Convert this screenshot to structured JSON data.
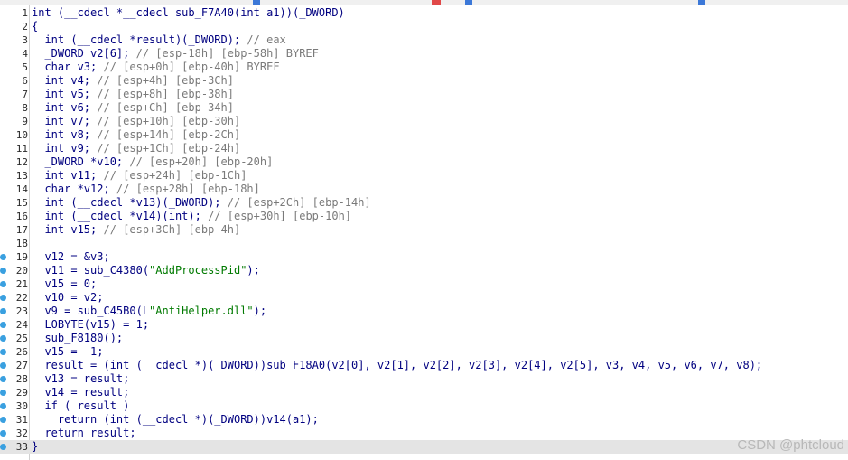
{
  "code_lines": [
    {
      "n": "1",
      "bp": false,
      "current": false,
      "text": "int (__cdecl *__cdecl sub_F7A40(int a1))(_DWORD)"
    },
    {
      "n": "2",
      "bp": false,
      "current": false,
      "text": "{"
    },
    {
      "n": "3",
      "bp": false,
      "current": false,
      "text": "  int (__cdecl *result)(_DWORD); // eax"
    },
    {
      "n": "4",
      "bp": false,
      "current": false,
      "text": "  _DWORD v2[6]; // [esp-18h] [ebp-58h] BYREF"
    },
    {
      "n": "5",
      "bp": false,
      "current": false,
      "text": "  char v3; // [esp+0h] [ebp-40h] BYREF"
    },
    {
      "n": "6",
      "bp": false,
      "current": false,
      "text": "  int v4; // [esp+4h] [ebp-3Ch]"
    },
    {
      "n": "7",
      "bp": false,
      "current": false,
      "text": "  int v5; // [esp+8h] [ebp-38h]"
    },
    {
      "n": "8",
      "bp": false,
      "current": false,
      "text": "  int v6; // [esp+Ch] [ebp-34h]"
    },
    {
      "n": "9",
      "bp": false,
      "current": false,
      "text": "  int v7; // [esp+10h] [ebp-30h]"
    },
    {
      "n": "10",
      "bp": false,
      "current": false,
      "text": "  int v8; // [esp+14h] [ebp-2Ch]"
    },
    {
      "n": "11",
      "bp": false,
      "current": false,
      "text": "  int v9; // [esp+1Ch] [ebp-24h]"
    },
    {
      "n": "12",
      "bp": false,
      "current": false,
      "text": "  _DWORD *v10; // [esp+20h] [ebp-20h]"
    },
    {
      "n": "13",
      "bp": false,
      "current": false,
      "text": "  int v11; // [esp+24h] [ebp-1Ch]"
    },
    {
      "n": "14",
      "bp": false,
      "current": false,
      "text": "  char *v12; // [esp+28h] [ebp-18h]"
    },
    {
      "n": "15",
      "bp": false,
      "current": false,
      "text": "  int (__cdecl *v13)(_DWORD); // [esp+2Ch] [ebp-14h]"
    },
    {
      "n": "16",
      "bp": false,
      "current": false,
      "text": "  int (__cdecl *v14)(int); // [esp+30h] [ebp-10h]"
    },
    {
      "n": "17",
      "bp": false,
      "current": false,
      "text": "  int v15; // [esp+3Ch] [ebp-4h]"
    },
    {
      "n": "18",
      "bp": false,
      "current": false,
      "text": ""
    },
    {
      "n": "19",
      "bp": true,
      "current": false,
      "text": "  v12 = &v3;"
    },
    {
      "n": "20",
      "bp": true,
      "current": false,
      "text": "  v11 = sub_C4380(\"AddProcessPid\");"
    },
    {
      "n": "21",
      "bp": true,
      "current": false,
      "text": "  v15 = 0;"
    },
    {
      "n": "22",
      "bp": true,
      "current": false,
      "text": "  v10 = v2;"
    },
    {
      "n": "23",
      "bp": true,
      "current": false,
      "text": "  v9 = sub_C45B0(L\"AntiHelper.dll\");"
    },
    {
      "n": "24",
      "bp": true,
      "current": false,
      "text": "  LOBYTE(v15) = 1;"
    },
    {
      "n": "25",
      "bp": true,
      "current": false,
      "text": "  sub_F8180();"
    },
    {
      "n": "26",
      "bp": true,
      "current": false,
      "text": "  v15 = -1;"
    },
    {
      "n": "27",
      "bp": true,
      "current": false,
      "text": "  result = (int (__cdecl *)(_DWORD))sub_F18A0(v2[0], v2[1], v2[2], v2[3], v2[4], v2[5], v3, v4, v5, v6, v7, v8);"
    },
    {
      "n": "28",
      "bp": true,
      "current": false,
      "text": "  v13 = result;"
    },
    {
      "n": "29",
      "bp": true,
      "current": false,
      "text": "  v14 = result;"
    },
    {
      "n": "30",
      "bp": true,
      "current": false,
      "text": "  if ( result )"
    },
    {
      "n": "31",
      "bp": true,
      "current": false,
      "text": "    return (int (__cdecl *)(_DWORD))v14(a1);"
    },
    {
      "n": "32",
      "bp": true,
      "current": false,
      "text": "  return result;"
    },
    {
      "n": "33",
      "bp": true,
      "current": true,
      "text": "}"
    }
  ],
  "watermark": "CSDN @phtcloud",
  "colors": {
    "code": "#000080",
    "comment": "#7a7a7a",
    "string": "#007a00",
    "breakpoint": "#3aa0e0",
    "current_line": "#e4e4e4"
  }
}
